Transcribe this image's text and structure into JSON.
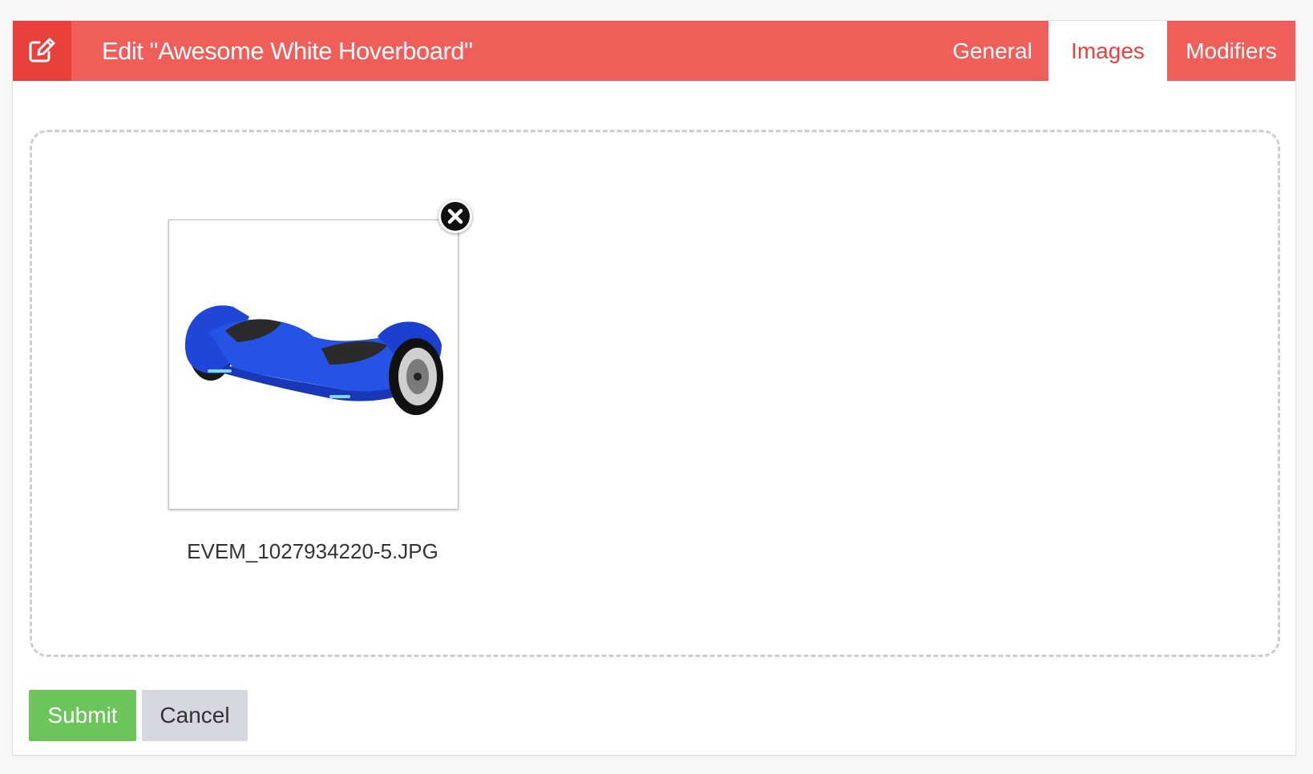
{
  "header": {
    "edit_icon": "pencil-square-icon",
    "title": "Edit \"Awesome White Hoverboard\"",
    "tabs": [
      {
        "label": "General",
        "active": false
      },
      {
        "label": "Images",
        "active": true
      },
      {
        "label": "Modifiers",
        "active": false
      }
    ]
  },
  "images": {
    "files": [
      {
        "filename": "EVEM_1027934220-5.JPG",
        "thumbnail": "blue-hoverboard",
        "remove_icon": "close-circle-icon"
      }
    ]
  },
  "actions": {
    "submit_label": "Submit",
    "cancel_label": "Cancel"
  },
  "colors": {
    "header_bg": "#f05e5a",
    "icon_box_bg": "#e8413c",
    "active_tab_text": "#e8413c",
    "submit_bg": "#6cc55a",
    "cancel_bg": "#d5d8df"
  }
}
